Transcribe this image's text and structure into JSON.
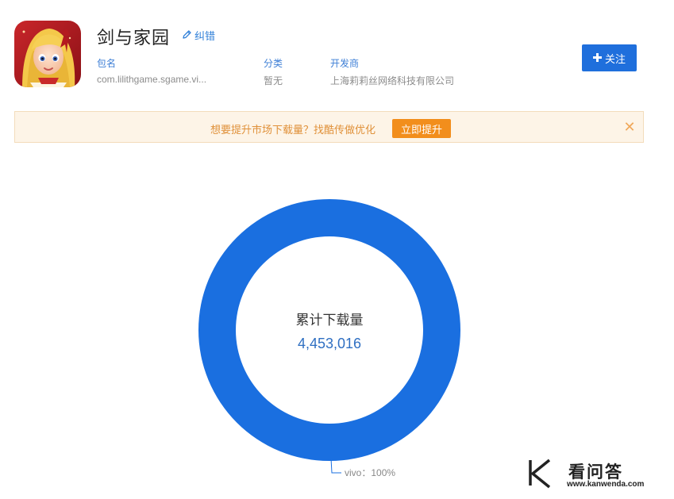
{
  "app": {
    "name": "剑与家园",
    "edit_label": "纠错",
    "follow_label": "关注"
  },
  "meta": [
    {
      "label": "包名",
      "value": "com.lilithgame.sgame.vi..."
    },
    {
      "label": "分类",
      "value": "暂无"
    },
    {
      "label": "开发商",
      "value": "上海莉莉丝网络科技有限公司"
    }
  ],
  "banner": {
    "text": "想要提升市场下载量？找酷传做优化",
    "button_label": "立即提升",
    "close_symbol": "✕"
  },
  "chart_data": {
    "type": "pie",
    "style": "donut",
    "center_title": "累计下载量",
    "center_value": "4,453,016",
    "slices": [
      {
        "label": "vivo",
        "value": 100,
        "display": "vivo：100%",
        "color": "#1a6fe0"
      }
    ]
  },
  "watermark": {
    "logo_letter": "K",
    "name": "看问答",
    "url": "www.kanwenda.com"
  },
  "colors": {
    "accent": "#1f6fdc",
    "donut": "#1a6fe0",
    "banner_bg": "#fdf4e7",
    "banner_text": "#e0913a",
    "banner_button": "#f28e1c"
  }
}
